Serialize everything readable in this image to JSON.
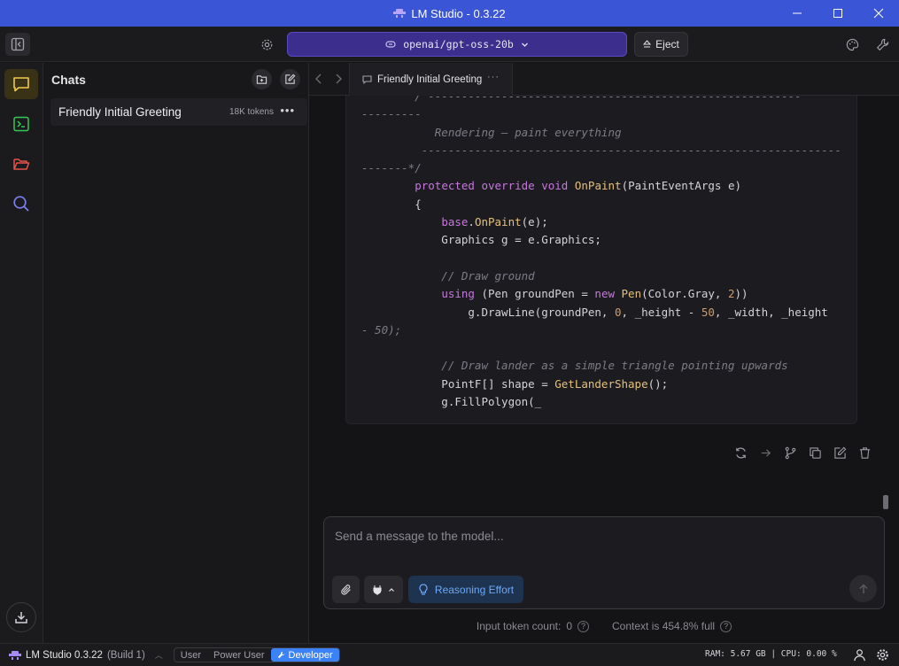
{
  "window": {
    "title": "LM Studio - 0.3.22",
    "controls": {
      "minimize": "—",
      "maximize": "☐",
      "close": "✕"
    }
  },
  "toolbar": {
    "model_name": "openai/gpt-oss-20b",
    "eject_label": "Eject"
  },
  "sidebar": {
    "items": [
      {
        "name": "chat",
        "icon": "chat-icon",
        "active": true
      },
      {
        "name": "developer",
        "icon": "terminal-icon",
        "active": false
      },
      {
        "name": "my-models",
        "icon": "folder-icon",
        "active": false
      },
      {
        "name": "discover",
        "icon": "search-icon",
        "active": false
      }
    ]
  },
  "chats": {
    "title": "Chats",
    "items": [
      {
        "title": "Friendly Initial Greeting",
        "tokens": "18K tokens"
      }
    ]
  },
  "tab": {
    "label": "Friendly Initial Greeting",
    "menu": "···"
  },
  "code": {
    "lines": [
      "        / --------------------------------------------------------",
      "---------",
      "           Rendering – paint everything",
      "         ---------------------------------------------------------------",
      "-------*/",
      "        protected override void OnPaint(PaintEventArgs e)",
      "        {",
      "            base.OnPaint(e);",
      "            Graphics g = e.Graphics;",
      "",
      "            // Draw ground",
      "            using (Pen groundPen = new Pen(Color.Gray, 2))",
      "                g.DrawLine(groundPen, 0, _height - 50, _width, _height",
      "- 50);",
      "",
      "            // Draw lander as a simple triangle pointing upwards",
      "            PointF[] shape = GetLanderShape();",
      "            g.FillPolygon(_"
    ]
  },
  "composer": {
    "placeholder": "Send a message to the model...",
    "reasoning_label": "Reasoning Effort"
  },
  "token_info": {
    "input_label": "Input token count:",
    "input_value": "0",
    "context_label": "Context is 454.8% full"
  },
  "status_bar": {
    "app_name": "LM Studio 0.3.22",
    "build": "(Build 1)",
    "modes": [
      "User",
      "Power User",
      "Developer"
    ],
    "active_mode": "Developer",
    "stats": "RAM: 5.67 GB  |  CPU: 0.00 %"
  },
  "colors": {
    "titlebar": "#3a55d6",
    "model_selector": "#3b2e8c",
    "active_rail": "#3a3216",
    "reasoning": "#1e3350",
    "developer_mode": "#3b82f6"
  }
}
